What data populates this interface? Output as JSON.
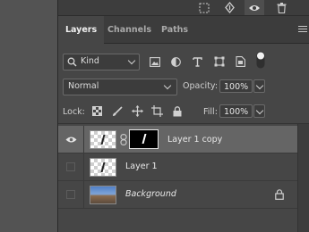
{
  "tabs": [
    {
      "label": "Layers",
      "active": true
    },
    {
      "label": "Channels",
      "active": false
    },
    {
      "label": "Paths",
      "active": false
    }
  ],
  "top_toolbar": {
    "icons": [
      "selection-icon",
      "move-icon",
      "eye-icon",
      "trash-icon"
    ]
  },
  "filter": {
    "kind_label": "Kind",
    "icons": [
      "image-filter-icon",
      "adjustment-filter-icon",
      "type-filter-icon",
      "shape-filter-icon",
      "smart-object-filter-icon",
      "filter-toggle-icon"
    ]
  },
  "blend": {
    "mode": "Normal",
    "opacity_label": "Opacity:",
    "opacity_value": "100%"
  },
  "lock": {
    "label": "Lock:",
    "fill_label": "Fill:",
    "fill_value": "100%"
  },
  "layers": [
    {
      "name": "Layer 1 copy",
      "visible": true,
      "selected": true,
      "has_mask": true,
      "locked": false
    },
    {
      "name": "Layer 1",
      "visible": false,
      "selected": false,
      "has_mask": false,
      "locked": false
    },
    {
      "name": "Background",
      "visible": false,
      "selected": false,
      "has_mask": false,
      "locked": true
    }
  ],
  "colors": {
    "panel_bg": "#464646",
    "selected_row": "#656565",
    "canvas_bg": "#535353"
  }
}
